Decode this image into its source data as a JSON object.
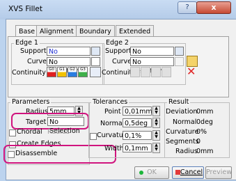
{
  "window": {
    "title": "XVS Fillet",
    "help_label": "?",
    "close_label": "x"
  },
  "tabs": [
    {
      "label": "Base"
    },
    {
      "label": "Alignment"
    },
    {
      "label": "Boundary"
    },
    {
      "label": "Extended"
    }
  ],
  "edge1": {
    "label": "Edge 1",
    "support_label": "Support",
    "support_value": "No Selection",
    "curve_label": "Curve",
    "curve_value": "No Selection",
    "continuity_label": "Continuity",
    "continuity_options": [
      "G0",
      "G1",
      "G2",
      "G3"
    ]
  },
  "edge2": {
    "label": "Edge 2",
    "support_label": "Support",
    "support_value": "No Selection",
    "curve_label": "Curve",
    "curve_value": "No Selection",
    "continuity_label": "Continuity"
  },
  "parameters": {
    "label": "Parameters",
    "radius_label": "Radius",
    "radius_value": "5mm",
    "target_label": "Target",
    "target_value": "No Selection",
    "chordal_label": "Chordal",
    "chordal_value": "Radius",
    "create_edges_label": "Create Edges",
    "disassemble_label": "Disassemble"
  },
  "tolerances": {
    "label": "Tolerances",
    "point_label": "Point",
    "point_value": "0,01mm",
    "normal_label": "Normal",
    "normal_value": "0,5deg",
    "curvature_label": "Curvature",
    "curvature_value": "0,1%",
    "width_label": "Width",
    "width_value": "0,1mm"
  },
  "result": {
    "label": "Result",
    "deviation_label": "Deviation",
    "deviation_value": "0mm",
    "normal_label": "Normal",
    "normal_value": "0deg",
    "curvature_label": "Curvature",
    "curvature_value": "0%",
    "segments_label": "Segments",
    "segments_value": "0",
    "radius_label": "Radius",
    "radius_value": "0mm"
  },
  "buttons": {
    "ok_label": "OK",
    "cancel_label": "Cancel",
    "preview_label": "Preview"
  },
  "colors": {
    "selection_text": "#1b2bd0",
    "highlight": "#d0147e"
  }
}
